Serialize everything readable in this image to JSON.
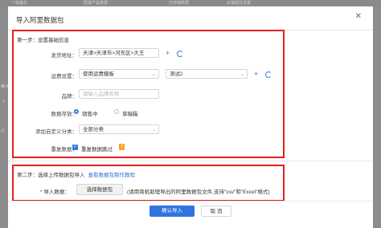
{
  "background": {
    "tabs": [
      "一级备份",
      "配置产品数据",
      "已存储数据",
      "必填属性设置"
    ],
    "side_texts": [
      "每大",
      "1",
      "行"
    ]
  },
  "dialog": {
    "title": "导入阿里数据包",
    "close_icon": "close-icon"
  },
  "step1": {
    "title": "第一步：设置基础信息",
    "ship_from": {
      "label": "发货地址：",
      "value": "天津>天津市>河东区>大王"
    },
    "freight": {
      "label": "运费设置：",
      "value": "使用运费模板",
      "template": "测试2"
    },
    "brand": {
      "label": "品牌：",
      "placeholder": "请输入品牌名称"
    },
    "storage": {
      "label": "数据存放：",
      "options": [
        "销售中",
        "草稿箱"
      ],
      "selected": "销售中"
    },
    "category": {
      "label": "添加自定义分类：",
      "value": "全部分类"
    },
    "duplicate": {
      "label": "重复数据：",
      "checkbox_label": "重复数据跳过"
    }
  },
  "step2": {
    "title": "第二步：选择上传数据包导入",
    "tutorial_link": "查看数据包制作教程",
    "import_label": "* 导入数据：",
    "choose_button": "选择数据包",
    "hint": "(请用商机助理导出的阿里数据包文件,支持\"csv\"和\"Excel\"格式)"
  },
  "footer": {
    "confirm": "确认导入",
    "cancel": "取 消"
  },
  "colors": {
    "accent": "#2f74e0",
    "highlight_border": "#e02020",
    "warning": "#f5a623"
  }
}
